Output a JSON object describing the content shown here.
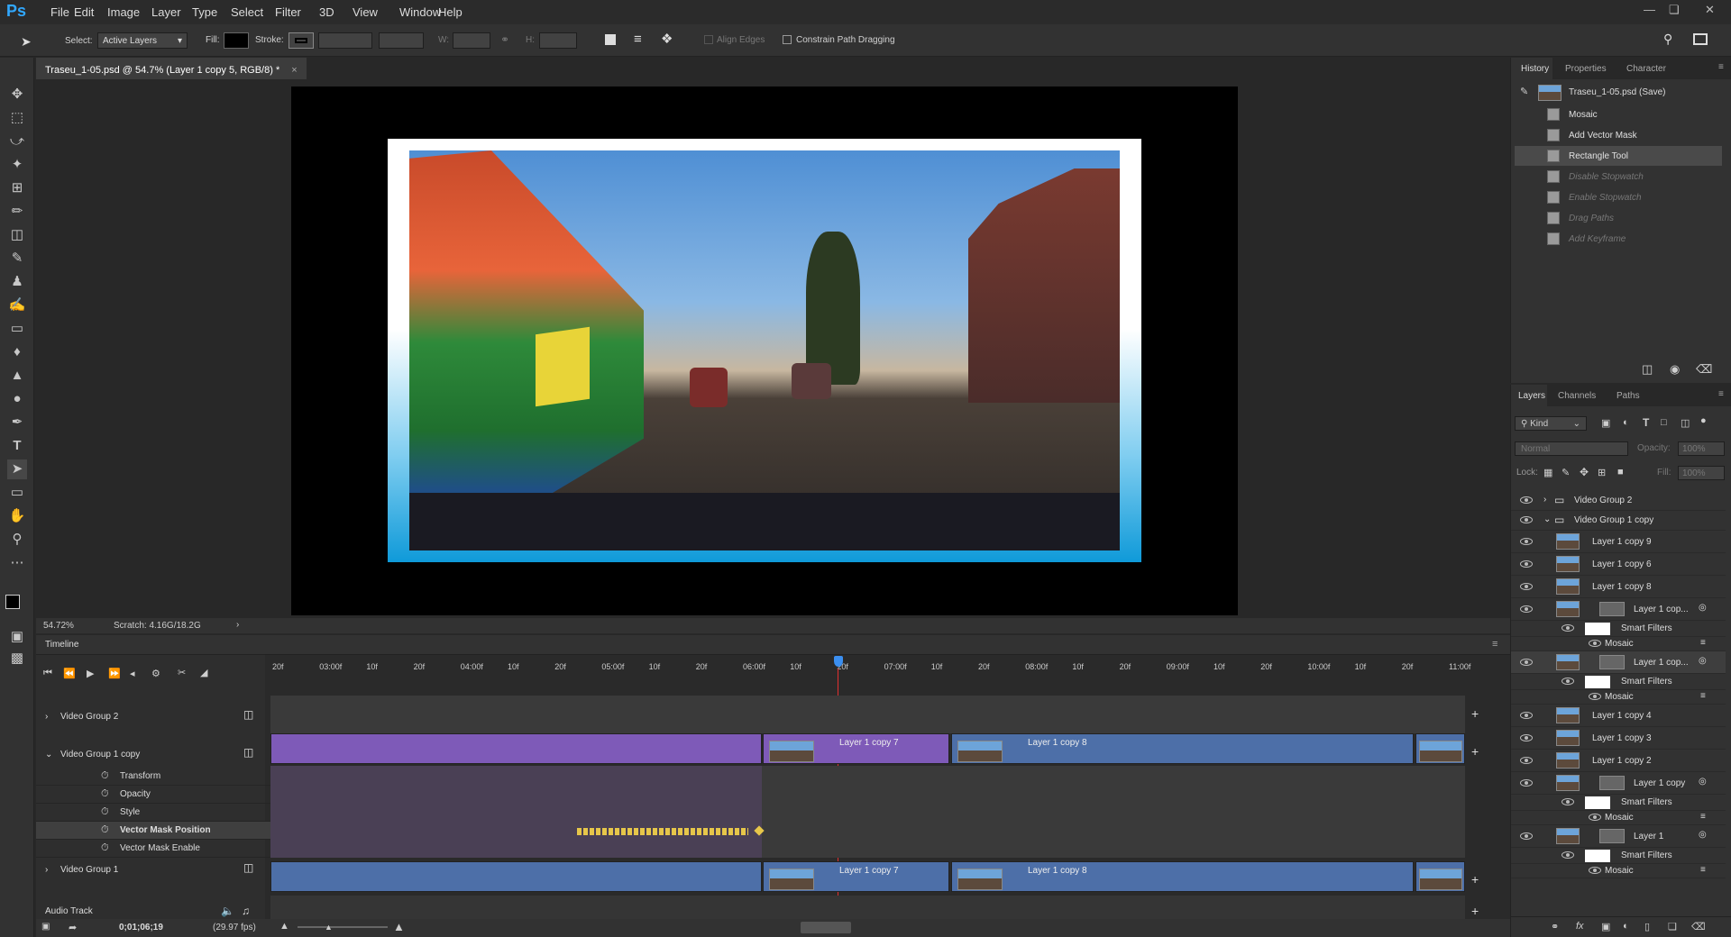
{
  "app": {
    "logo": "Ps",
    "menus": [
      "File",
      "Edit",
      "Image",
      "Layer",
      "Type",
      "Select",
      "Filter",
      "3D",
      "View",
      "Window",
      "Help"
    ]
  },
  "options": {
    "select_label": "Select:",
    "select_value": "Active Layers",
    "fill_label": "Fill:",
    "stroke_label": "Stroke:",
    "w_label": "W:",
    "h_label": "H:",
    "align_edges": "Align Edges",
    "constrain": "Constrain Path Dragging"
  },
  "document": {
    "tab_title": "Traseu_1-05.psd @ 54.7% (Layer 1 copy 5, RGB/8) *",
    "close": "×"
  },
  "status": {
    "zoom": "54.72%",
    "scratch": "Scratch: 4.16G/18.2G"
  },
  "history": {
    "tabs": [
      "History",
      "Properties",
      "Character"
    ],
    "snapshot": "Traseu_1-05.psd (Save)",
    "items": [
      {
        "label": "Mosaic",
        "dim": false
      },
      {
        "label": "Add Vector Mask",
        "dim": false
      },
      {
        "label": "Rectangle Tool",
        "dim": false,
        "selected": true
      },
      {
        "label": "Disable Stopwatch",
        "dim": true
      },
      {
        "label": "Enable Stopwatch",
        "dim": true
      },
      {
        "label": "Drag Paths",
        "dim": true
      },
      {
        "label": "Add Keyframe",
        "dim": true
      }
    ]
  },
  "layers": {
    "tabs": [
      "Layers",
      "Channels",
      "Paths"
    ],
    "kind": "Kind",
    "blend": "Normal",
    "opacity_label": "Opacity:",
    "opacity_value": "100%",
    "lock_label": "Lock:",
    "fill_label": "Fill:",
    "fill_value": "100%",
    "rows": [
      {
        "label": "Video Group 2",
        "type": "group",
        "indent": 0
      },
      {
        "label": "Video Group 1 copy",
        "type": "group-open",
        "indent": 0
      },
      {
        "label": "Layer 1 copy 9",
        "type": "layer",
        "indent": 1
      },
      {
        "label": "Layer 1 copy 6",
        "type": "layer",
        "indent": 1
      },
      {
        "label": "Layer 1 copy 8",
        "type": "layer",
        "indent": 1
      },
      {
        "label": "Layer 1 cop...",
        "type": "smart",
        "indent": 1
      },
      {
        "label": "Smart Filters",
        "type": "filters",
        "indent": 2
      },
      {
        "label": "Mosaic",
        "type": "filter",
        "indent": 2
      },
      {
        "label": "Layer 1 cop...",
        "type": "smart",
        "indent": 1
      },
      {
        "label": "Smart Filters",
        "type": "filters",
        "indent": 2
      },
      {
        "label": "Mosaic",
        "type": "filter",
        "indent": 2
      },
      {
        "label": "Layer 1 copy 4",
        "type": "layer",
        "indent": 1
      },
      {
        "label": "Layer 1 copy 3",
        "type": "layer",
        "indent": 1
      },
      {
        "label": "Layer 1 copy 2",
        "type": "layer",
        "indent": 1
      },
      {
        "label": "Layer 1 copy",
        "type": "smart",
        "indent": 1
      },
      {
        "label": "Smart Filters",
        "type": "filters",
        "indent": 2
      },
      {
        "label": "Mosaic",
        "type": "filter",
        "indent": 2
      },
      {
        "label": "Layer 1",
        "type": "smart",
        "indent": 1
      },
      {
        "label": "Smart Filters",
        "type": "filters",
        "indent": 2
      },
      {
        "label": "Mosaic",
        "type": "filter",
        "indent": 2
      }
    ]
  },
  "timeline": {
    "title": "Timeline",
    "ruler": [
      "20f",
      "03:00f",
      "10f",
      "20f",
      "04:00f",
      "10f",
      "20f",
      "05:00f",
      "10f",
      "20f",
      "06:00f",
      "10f",
      "20f",
      "07:00f",
      "10f",
      "20f",
      "08:00f",
      "10f",
      "20f",
      "09:00f",
      "10f",
      "20f",
      "10:00f",
      "10f",
      "20f",
      "11:00f"
    ],
    "tracks": {
      "vg2": "Video Group 2",
      "vg1copy": "Video Group 1 copy",
      "vg1": "Video Group 1",
      "audio": "Audio Track"
    },
    "props": [
      "Transform",
      "Opacity",
      "Style",
      "Vector Mask Position",
      "Vector Mask Enable"
    ],
    "clips": {
      "c7": "Layer 1 copy 7",
      "c8": "Layer 1 copy 8"
    },
    "timecode": "0;01;06;19",
    "fps": "(29.97 fps)",
    "playhead_time": "06:20f"
  }
}
